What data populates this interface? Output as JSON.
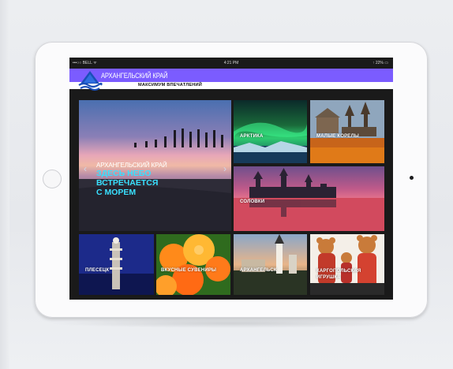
{
  "status_bar": {
    "carrier": "•••○○ BELL ᯤ",
    "time": "4:21 PM",
    "battery": "↑ 22% ▭"
  },
  "header": {
    "title": "АРХАНГЕЛЬСКИЙ КРАЙ",
    "subtitle": "МАКСИМУМ ВПЕЧАТЛЕНИЙ",
    "brand_color": "#7b5cff"
  },
  "hero": {
    "title": "АРХАНГЕЛЬСКИЙ КРАЙ",
    "lines": [
      "ЗДЕСЬ НЕБО",
      "ВСТРЕЧАЕТСЯ",
      "С МОРЕМ"
    ],
    "prev_icon": "chevron-left-icon",
    "next_icon": "chevron-right-icon"
  },
  "tiles": [
    {
      "label": "АРКТИКА"
    },
    {
      "label": "МАЛЫЕ КОРЕЛЫ"
    },
    {
      "label": "СОЛОВКИ"
    },
    {
      "label": "ПЛЕСЕЦК"
    },
    {
      "label": "ВКУСНЫЕ СУВЕНИРЫ"
    },
    {
      "label": "АРХАНГЕЛЬСК"
    },
    {
      "label_line1": "КАРГОПОЛЬСКАЯ",
      "label_line2": "ИГРУШКА"
    }
  ]
}
